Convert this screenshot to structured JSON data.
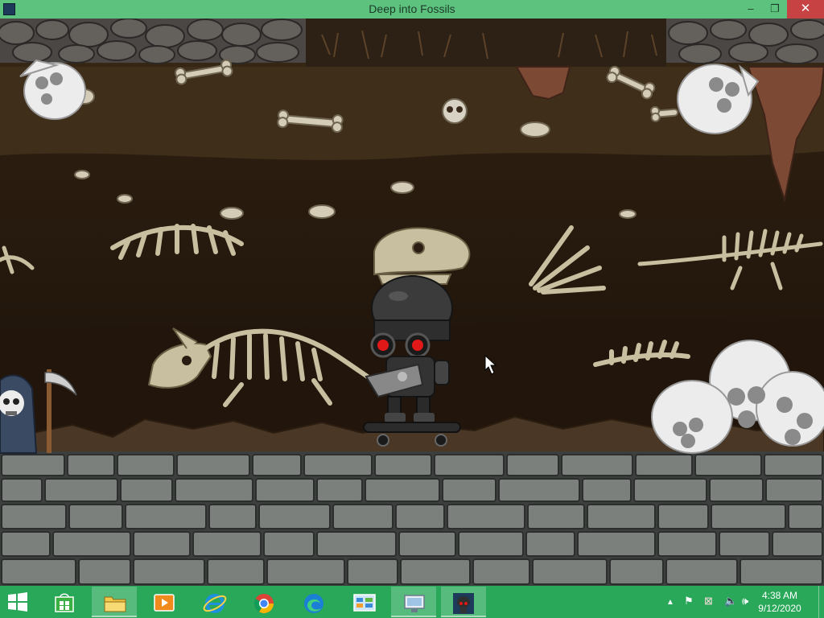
{
  "window": {
    "title": "Deep into Fossils",
    "buttons": {
      "minimize": "–",
      "maximize": "❐",
      "close": "✕"
    }
  },
  "taskbar": {
    "items": [
      {
        "name": "start-button"
      },
      {
        "name": "store-app"
      },
      {
        "name": "file-explorer"
      },
      {
        "name": "media-player"
      },
      {
        "name": "internet-explorer"
      },
      {
        "name": "chrome"
      },
      {
        "name": "edge"
      },
      {
        "name": "control-panel"
      },
      {
        "name": "remote-desktop"
      },
      {
        "name": "deep-into-fossils-game"
      }
    ],
    "active_item": "deep-into-fossils-game",
    "clock": {
      "time": "4:38 AM",
      "date": "9/12/2020"
    }
  },
  "colors": {
    "titlebar": "#5ec27f",
    "taskbar": "#2aa85a",
    "close_button": "#c74343",
    "robot_eye": "#e01818"
  }
}
